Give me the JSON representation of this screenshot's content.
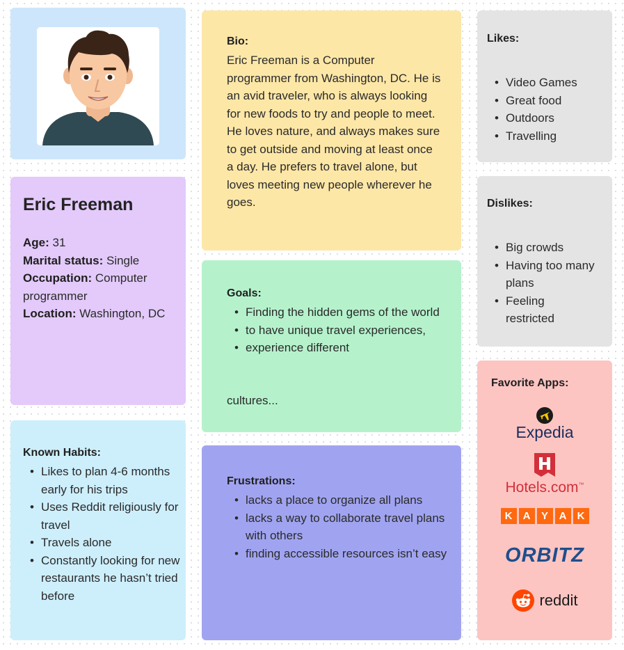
{
  "profile": {
    "name": "Eric Freeman",
    "age_label": "Age:",
    "age": "31",
    "marital_label": "Marital status:",
    "marital": "Single",
    "occupation_label": "Occupation:",
    "occupation": "Computer programmer",
    "location_label": "Location:",
    "location": "Washington, DC"
  },
  "bio": {
    "label": "Bio:",
    "text": "Eric Freeman is a Computer programmer from Washington, DC. He is an avid traveler, who is always looking for new foods to try and people to meet. He loves nature, and always makes sure to get outside and moving at least once a day. He prefers to travel alone, but loves meeting new people wherever he goes."
  },
  "likes": {
    "label": "Likes:",
    "items": [
      "Video Games",
      "Great food",
      "Outdoors",
      "Travelling"
    ]
  },
  "dislikes": {
    "label": "Dislikes:",
    "items": [
      "Big crowds",
      "Having too many plans",
      "Feeling restricted"
    ]
  },
  "goals": {
    "label": "Goals:",
    "items": [
      "Finding the hidden gems of the world",
      "to have unique travel experiences,",
      "experience different"
    ],
    "trailing": "cultures..."
  },
  "habits": {
    "label": "Known Habits:",
    "items": [
      "Likes to plan 4-6 months early for his trips",
      "Uses Reddit religiously for travel",
      "Travels alone",
      "Constantly looking for new restaurants he hasn’t tried before"
    ]
  },
  "frustrations": {
    "label": "Frustrations:",
    "items": [
      "lacks a place to organize all plans",
      "lacks a way to collaborate travel plans with others",
      "finding accessible resources isn’t easy"
    ]
  },
  "apps": {
    "label": "Favorite Apps:",
    "expedia": "Expedia",
    "hotels": "Hotels.com",
    "hotels_tm": "™",
    "kayak_letters": [
      "K",
      "A",
      "Y",
      "A",
      "K"
    ],
    "orbitz": "ORBITZ",
    "reddit": "reddit"
  },
  "colors": {
    "avatar_bg": "#cde6fb",
    "profile_bg": "#e3cafa",
    "habits_bg": "#cdeffc",
    "bio_bg": "#fde7a7",
    "goals_bg": "#b5f2cc",
    "frustrations_bg": "#a0a4f0",
    "likes_bg": "#e4e4e4",
    "apps_bg": "#fcc5c2",
    "hotels_red": "#d32f3a",
    "kayak_orange": "#ff690f",
    "orbitz_blue": "#1f4e8c",
    "reddit_orange": "#ff4500"
  }
}
